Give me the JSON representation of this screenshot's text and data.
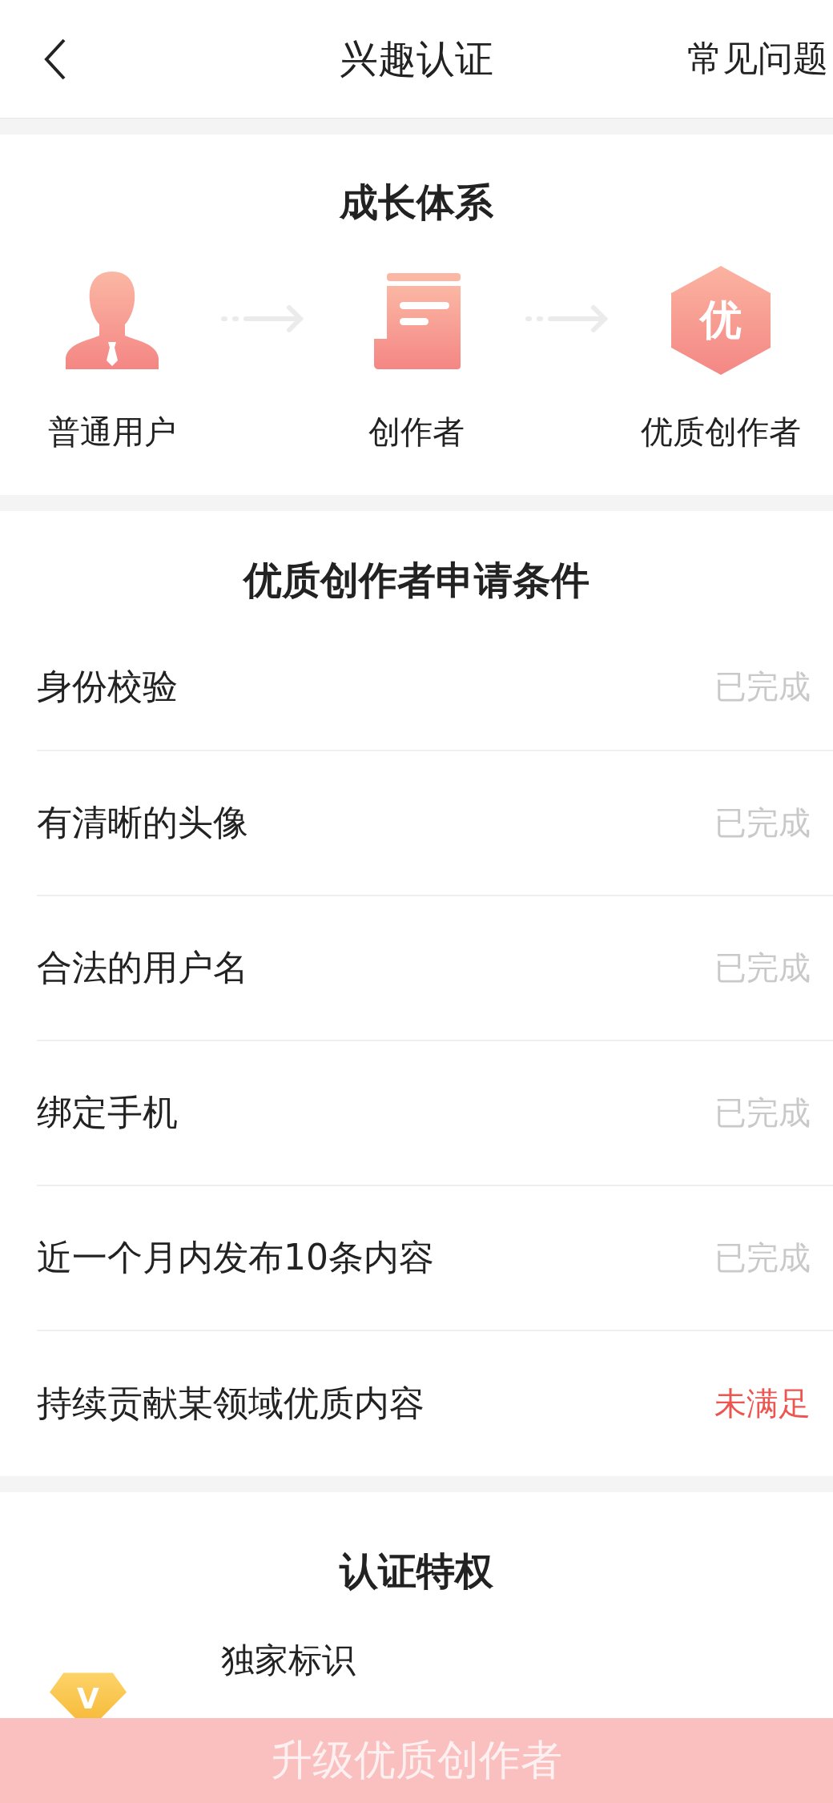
{
  "nav": {
    "title": "兴趣认证",
    "faq": "常见问题"
  },
  "growth": {
    "title": "成长体系",
    "stages": [
      {
        "kind": "user",
        "label": "普通用户"
      },
      {
        "kind": "doc",
        "label": "创作者"
      },
      {
        "kind": "badge",
        "label": "优质创作者",
        "badge_text": "优"
      }
    ]
  },
  "conditions": {
    "title": "优质创作者申请条件",
    "items": [
      {
        "label": "身份校验",
        "status": "已完成",
        "met": true
      },
      {
        "label": "有清晰的头像",
        "status": "已完成",
        "met": true
      },
      {
        "label": "合法的用户名",
        "status": "已完成",
        "met": true
      },
      {
        "label": "绑定手机",
        "status": "已完成",
        "met": true
      },
      {
        "label": "近一个月内发布10条内容",
        "status": "已完成",
        "met": true
      },
      {
        "label": "持续贡献某领域优质内容",
        "status": "未满足",
        "met": false
      }
    ]
  },
  "privileges": {
    "title": "认证特权",
    "items": [
      {
        "title": "独家标识",
        "icon_text": "V"
      }
    ]
  },
  "action": {
    "label": "升级优质创作者",
    "disabled": true
  }
}
